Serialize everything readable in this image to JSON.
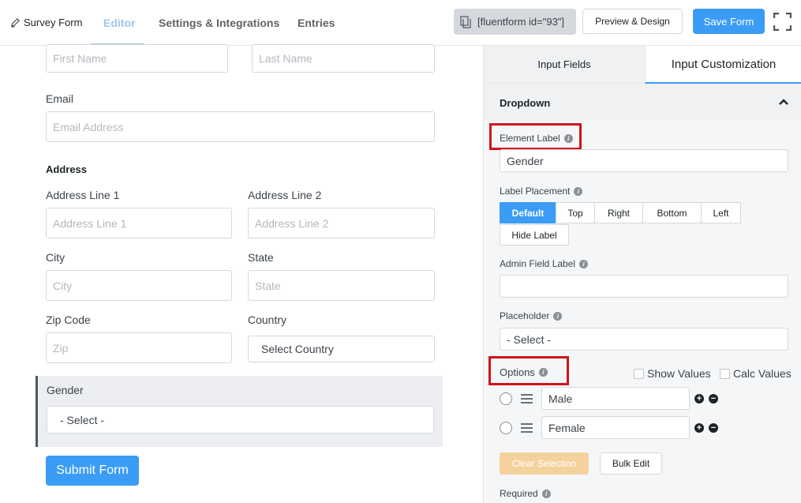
{
  "topbar": {
    "brand": "Survey Form",
    "tabs": [
      "Editor",
      "Settings & Integrations",
      "Entries"
    ],
    "active_tab": "Editor",
    "shortcode": "[fluentform id=\"93\"]",
    "preview_label": "Preview & Design",
    "save_label": "Save Form"
  },
  "form": {
    "first_name_placeholder": "First Name",
    "last_name_placeholder": "Last Name",
    "email_label": "Email",
    "email_placeholder": "Email Address",
    "address_label": "Address",
    "address_line1_label": "Address Line 1",
    "address_line1_placeholder": "Address Line 1",
    "address_line2_label": "Address Line 2",
    "address_line2_placeholder": "Address Line 2",
    "city_label": "City",
    "city_placeholder": "City",
    "state_label": "State",
    "state_placeholder": "State",
    "zip_label": "Zip Code",
    "zip_placeholder": "Zip",
    "country_label": "Country",
    "country_value": "Select Country",
    "gender_label": "Gender",
    "gender_value": "- Select -",
    "submit_label": "Submit Form"
  },
  "panel": {
    "tabs": [
      "Input Fields",
      "Input Customization"
    ],
    "active_tab": "Input Customization",
    "section_title": "Dropdown",
    "element_label_label": "Element Label",
    "element_label_value": "Gender",
    "label_placement_label": "Label Placement",
    "placement_options": [
      "Default",
      "Top",
      "Right",
      "Bottom",
      "Left",
      "Hide Label"
    ],
    "placement_selected": "Default",
    "admin_field_label": "Admin Field Label",
    "admin_field_value": "",
    "placeholder_label": "Placeholder",
    "placeholder_value": "- Select -",
    "options_label": "Options",
    "show_values_label": "Show Values",
    "calc_values_label": "Calc Values",
    "options": [
      "Male",
      "Female"
    ],
    "clear_selection_label": "Clear Selection",
    "bulk_edit_label": "Bulk Edit",
    "required_label": "Required"
  },
  "colors": {
    "accent": "#3b9cf5",
    "highlight_box": "#d3131a",
    "clear_button": "#f4d29e"
  }
}
